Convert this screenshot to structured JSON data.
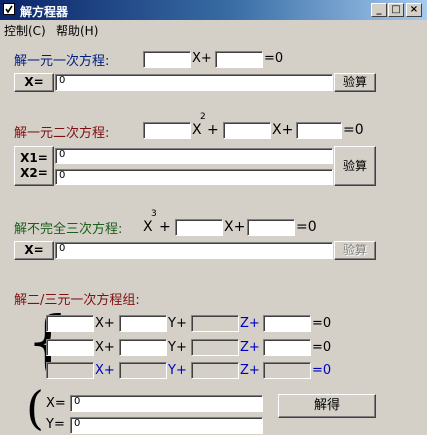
{
  "window": {
    "title": "解方程器",
    "minimize": "_",
    "maximize": "□",
    "close": "×"
  },
  "menu": {
    "items": [
      {
        "label": "控制(C)"
      },
      {
        "label": "帮助(H)"
      }
    ]
  },
  "linear": {
    "title": "解一元一次方程:",
    "x_plus": "X+",
    "eq_zero": "=0",
    "result_label": "X=",
    "result_value": "0",
    "verify": "验算"
  },
  "quadratic": {
    "title": "解一元二次方程:",
    "x": "X",
    "exp": "2",
    "plus": "+",
    "x_plus": "X+",
    "eq_zero": "=0",
    "x1_label": "X1=",
    "x2_label": "X2=",
    "x1_value": "0",
    "x2_value": "0",
    "verify": "验算"
  },
  "cubic": {
    "title": "解不完全三次方程:",
    "x": "X",
    "exp": "3",
    "plus": "+",
    "x_plus": "X+",
    "eq_zero": "=0",
    "result_label": "X=",
    "result_value": "0",
    "verify": "验算"
  },
  "system": {
    "title": "解二/三元一次方程组:",
    "x_plus": "X+",
    "y_plus": "Y+",
    "z_plus": "Z+",
    "eq_zero": "=0",
    "results": [
      {
        "label": "X=",
        "value": "0"
      },
      {
        "label": "Y=",
        "value": "0"
      }
    ],
    "solve": "解得"
  }
}
